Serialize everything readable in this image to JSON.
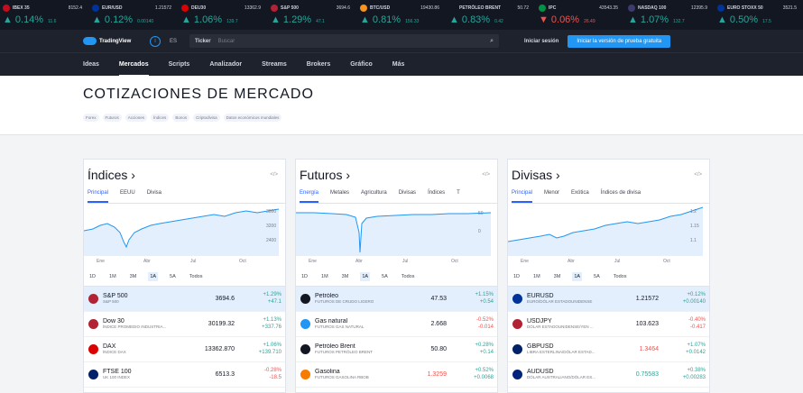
{
  "ticker": [
    {
      "name": "IBEX 35",
      "price": "8152.4",
      "pct": "0.14%",
      "abs": "11.6",
      "dir": "up",
      "flag": "#c60b1e",
      "arrow": "▲"
    },
    {
      "name": "EUR/USD",
      "price": "1.21572",
      "pct": "0.12%",
      "abs": "0.00140",
      "dir": "up",
      "flag": "#003399",
      "arrow": "▲"
    },
    {
      "name": "DEU30",
      "price": "13362.9",
      "pct": "1.06%",
      "abs": "139.7",
      "dir": "up",
      "flag": "#dd0000",
      "arrow": "▲"
    },
    {
      "name": "S&P 500",
      "price": "3694.6",
      "pct": "1.29%",
      "abs": "47.1",
      "dir": "up",
      "flag": "#b22234",
      "arrow": "▲"
    },
    {
      "name": "BTC/USD",
      "price": "19430.86",
      "pct": "0.81%",
      "abs": "156.33",
      "dir": "up",
      "flag": "#f7931a",
      "arrow": "▲"
    },
    {
      "name": "PETRÓLEO BRENT",
      "price": "50.72",
      "pct": "0.83%",
      "abs": "0.42",
      "dir": "up",
      "flag": "#131722",
      "arrow": "▲"
    },
    {
      "name": "IPC",
      "price": "43543.35",
      "pct": "0.06%",
      "abs": "26.49",
      "dir": "dn",
      "flag": "#009246",
      "arrow": "▼"
    },
    {
      "name": "NASDAQ 100",
      "price": "12395.9",
      "pct": "1.07%",
      "abs": "132.7",
      "dir": "up",
      "flag": "#3c3b6e",
      "arrow": "▲"
    },
    {
      "name": "EURO STOXX 50",
      "price": "3521.5",
      "pct": "0.50%",
      "abs": "17.5",
      "dir": "up",
      "flag": "#003399",
      "arrow": "▲"
    }
  ],
  "header": {
    "logo": "TradingView",
    "lang": "ES",
    "search_label": "Ticker",
    "search_placeholder": "Buscar",
    "signin": "Iniciar sesión",
    "trial": "Iniciar la versión de prueba gratuita"
  },
  "nav": [
    "Ideas",
    "Mercados",
    "Scripts",
    "Analizador",
    "Streams",
    "Brokers",
    "Gráfico",
    "Más"
  ],
  "page": {
    "title": "COTIZACIONES DE MERCADO",
    "pills": [
      "Forex",
      "Futuros",
      "Acciones",
      "Índices",
      "Bonos",
      "Criptodivisa",
      "Datos económicos mundiales"
    ]
  },
  "cards": [
    {
      "title": "Índices ›",
      "embed": "</>",
      "tabs": [
        "Principal",
        "EEUU",
        "Divisa"
      ],
      "axis_y": [
        "3600",
        "3200",
        "2400"
      ],
      "axis_x": [
        "Ene",
        "Abr",
        "Jul",
        "Oct"
      ],
      "ranges": [
        "1D",
        "1M",
        "3M",
        "1A",
        "5A",
        "Todos"
      ],
      "rows": [
        {
          "name": "S&P 500",
          "sub": "S&P 500",
          "value": "3694.6",
          "pct": "+1.29%",
          "abs": "+47.1",
          "dir": "up",
          "color": "#b22234"
        },
        {
          "name": "Dow 30",
          "sub": "ÍNDICE PROMEDIO INDUSTRIA...",
          "value": "30199.32",
          "pct": "+1.13%",
          "abs": "+337.76",
          "dir": "up",
          "color": "#b22234"
        },
        {
          "name": "DAX",
          "sub": "ÍNDICE DAX",
          "value": "13362.870",
          "pct": "+1.06%",
          "abs": "+139.710",
          "dir": "up",
          "color": "#dd0000"
        },
        {
          "name": "FTSE 100",
          "sub": "UK 100 INDEX",
          "value": "6513.3",
          "pct": "-0.28%",
          "abs": "-18.5",
          "dir": "dn",
          "color": "#012169"
        }
      ]
    },
    {
      "title": "Futuros ›",
      "embed": "</>",
      "tabs": [
        "Energía",
        "Metales",
        "Agricultura",
        "Divisas",
        "Índices",
        "T"
      ],
      "axis_y": [
        "50",
        "0"
      ],
      "axis_x": [
        "Ene",
        "Abr",
        "Jul",
        "Oct"
      ],
      "ranges": [
        "1D",
        "1M",
        "3M",
        "1A",
        "5A",
        "Todos"
      ],
      "rows": [
        {
          "name": "Petróleo",
          "sub": "FUTUROS DE CRUDO LIGERO",
          "value": "47.53",
          "pct": "+1.15%",
          "abs": "+0.54",
          "dir": "up",
          "color": "#131722"
        },
        {
          "name": "Gas natural",
          "sub": "FUTUROS GAS NATURAL",
          "value": "2.668",
          "pct": "-0.52%",
          "abs": "-0.014",
          "dir": "dn",
          "color": "#2196f3"
        },
        {
          "name": "Petróleo Brent",
          "sub": "FUTUROS PETRÓLEO BRENT",
          "value": "50.80",
          "pct": "+0.28%",
          "abs": "+0.14",
          "dir": "up",
          "color": "#131722"
        },
        {
          "name": "Gasolina",
          "sub": "FUTUROS GASOLINA RBOB",
          "value": "1.3259",
          "pct": "+0.52%",
          "abs": "+0.0068",
          "dir": "up",
          "value_dir": "dn",
          "color": "#f57c00"
        }
      ]
    },
    {
      "title": "Divisas ›",
      "embed": "</>",
      "tabs": [
        "Principal",
        "Menor",
        "Exótica",
        "Índices de divisa"
      ],
      "axis_y": [
        "1.2",
        "1.15",
        "1.1"
      ],
      "axis_x": [
        "Ene",
        "Abr",
        "Jul",
        "Oct"
      ],
      "ranges": [
        "1D",
        "1M",
        "3M",
        "1A",
        "5A",
        "Todos"
      ],
      "rows": [
        {
          "name": "EURUSD",
          "sub": "EURO/DÓLAR ESTADOUNIDENSE",
          "value": "1.21572",
          "pct": "+0.12%",
          "abs": "+0.00140",
          "dir": "up",
          "color": "#003399"
        },
        {
          "name": "USDJPY",
          "sub": "DÓLAR ESTADOUNIDENSE/YEN ...",
          "value": "103.623",
          "pct": "-0.40%",
          "abs": "-0.417",
          "dir": "dn",
          "color": "#b22234"
        },
        {
          "name": "GBPUSD",
          "sub": "LIBRA ESTERLINA/DÓLAR ESTAD...",
          "value": "1.3464",
          "pct": "+1.07%",
          "abs": "+0.0142",
          "dir": "up",
          "value_dir": "dn",
          "color": "#012169"
        },
        {
          "name": "AUDUSD",
          "sub": "DÓLAR AUSTRALIANO/DÓLAR ES...",
          "value": "0.75583",
          "pct": "+0.38%",
          "abs": "+0.00283",
          "dir": "up",
          "value_dir": "up",
          "color": "#00247d"
        }
      ]
    }
  ]
}
